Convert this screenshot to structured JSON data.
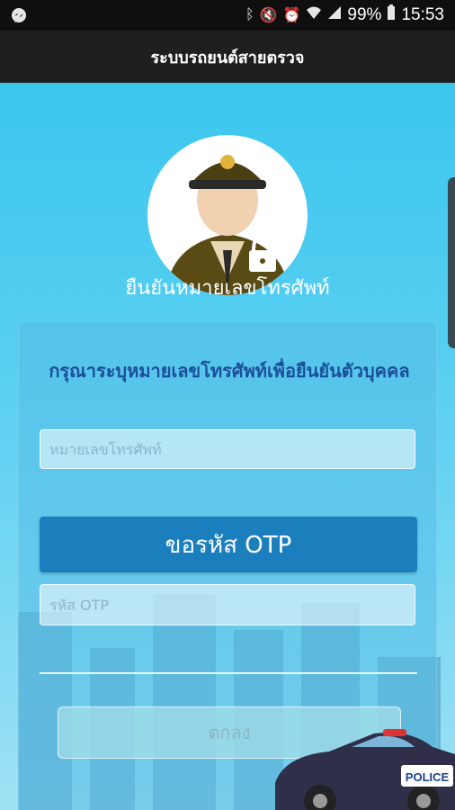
{
  "status_bar": {
    "battery": "99%",
    "time": "15:53",
    "icons": [
      "messenger-icon",
      "bluetooth-icon",
      "mute-icon",
      "alarm-icon",
      "wifi-icon",
      "signal-icon",
      "battery-icon"
    ]
  },
  "app_bar": {
    "title": "ระบบรถยนต์สายตรวจ"
  },
  "page": {
    "subtitle": "ยืนยันหมายเลขโทรศัพท์",
    "instruction": "กรุณาระบุหมายเลขโทรศัพท์เพื่อยืนยันตัวบุคคล",
    "phone_placeholder": "หมายเลขโทรศัพท์",
    "phone_value": "",
    "request_otp_label": "ขอรหัส OTP",
    "otp_placeholder": "รหัส OTP",
    "otp_value": "",
    "confirm_label": "ตกลง",
    "car_text": "POLICE"
  },
  "colors": {
    "accent": "#1b7fbe",
    "background_top": "#3cc6ee",
    "instruction_text": "#1b4f9a"
  }
}
